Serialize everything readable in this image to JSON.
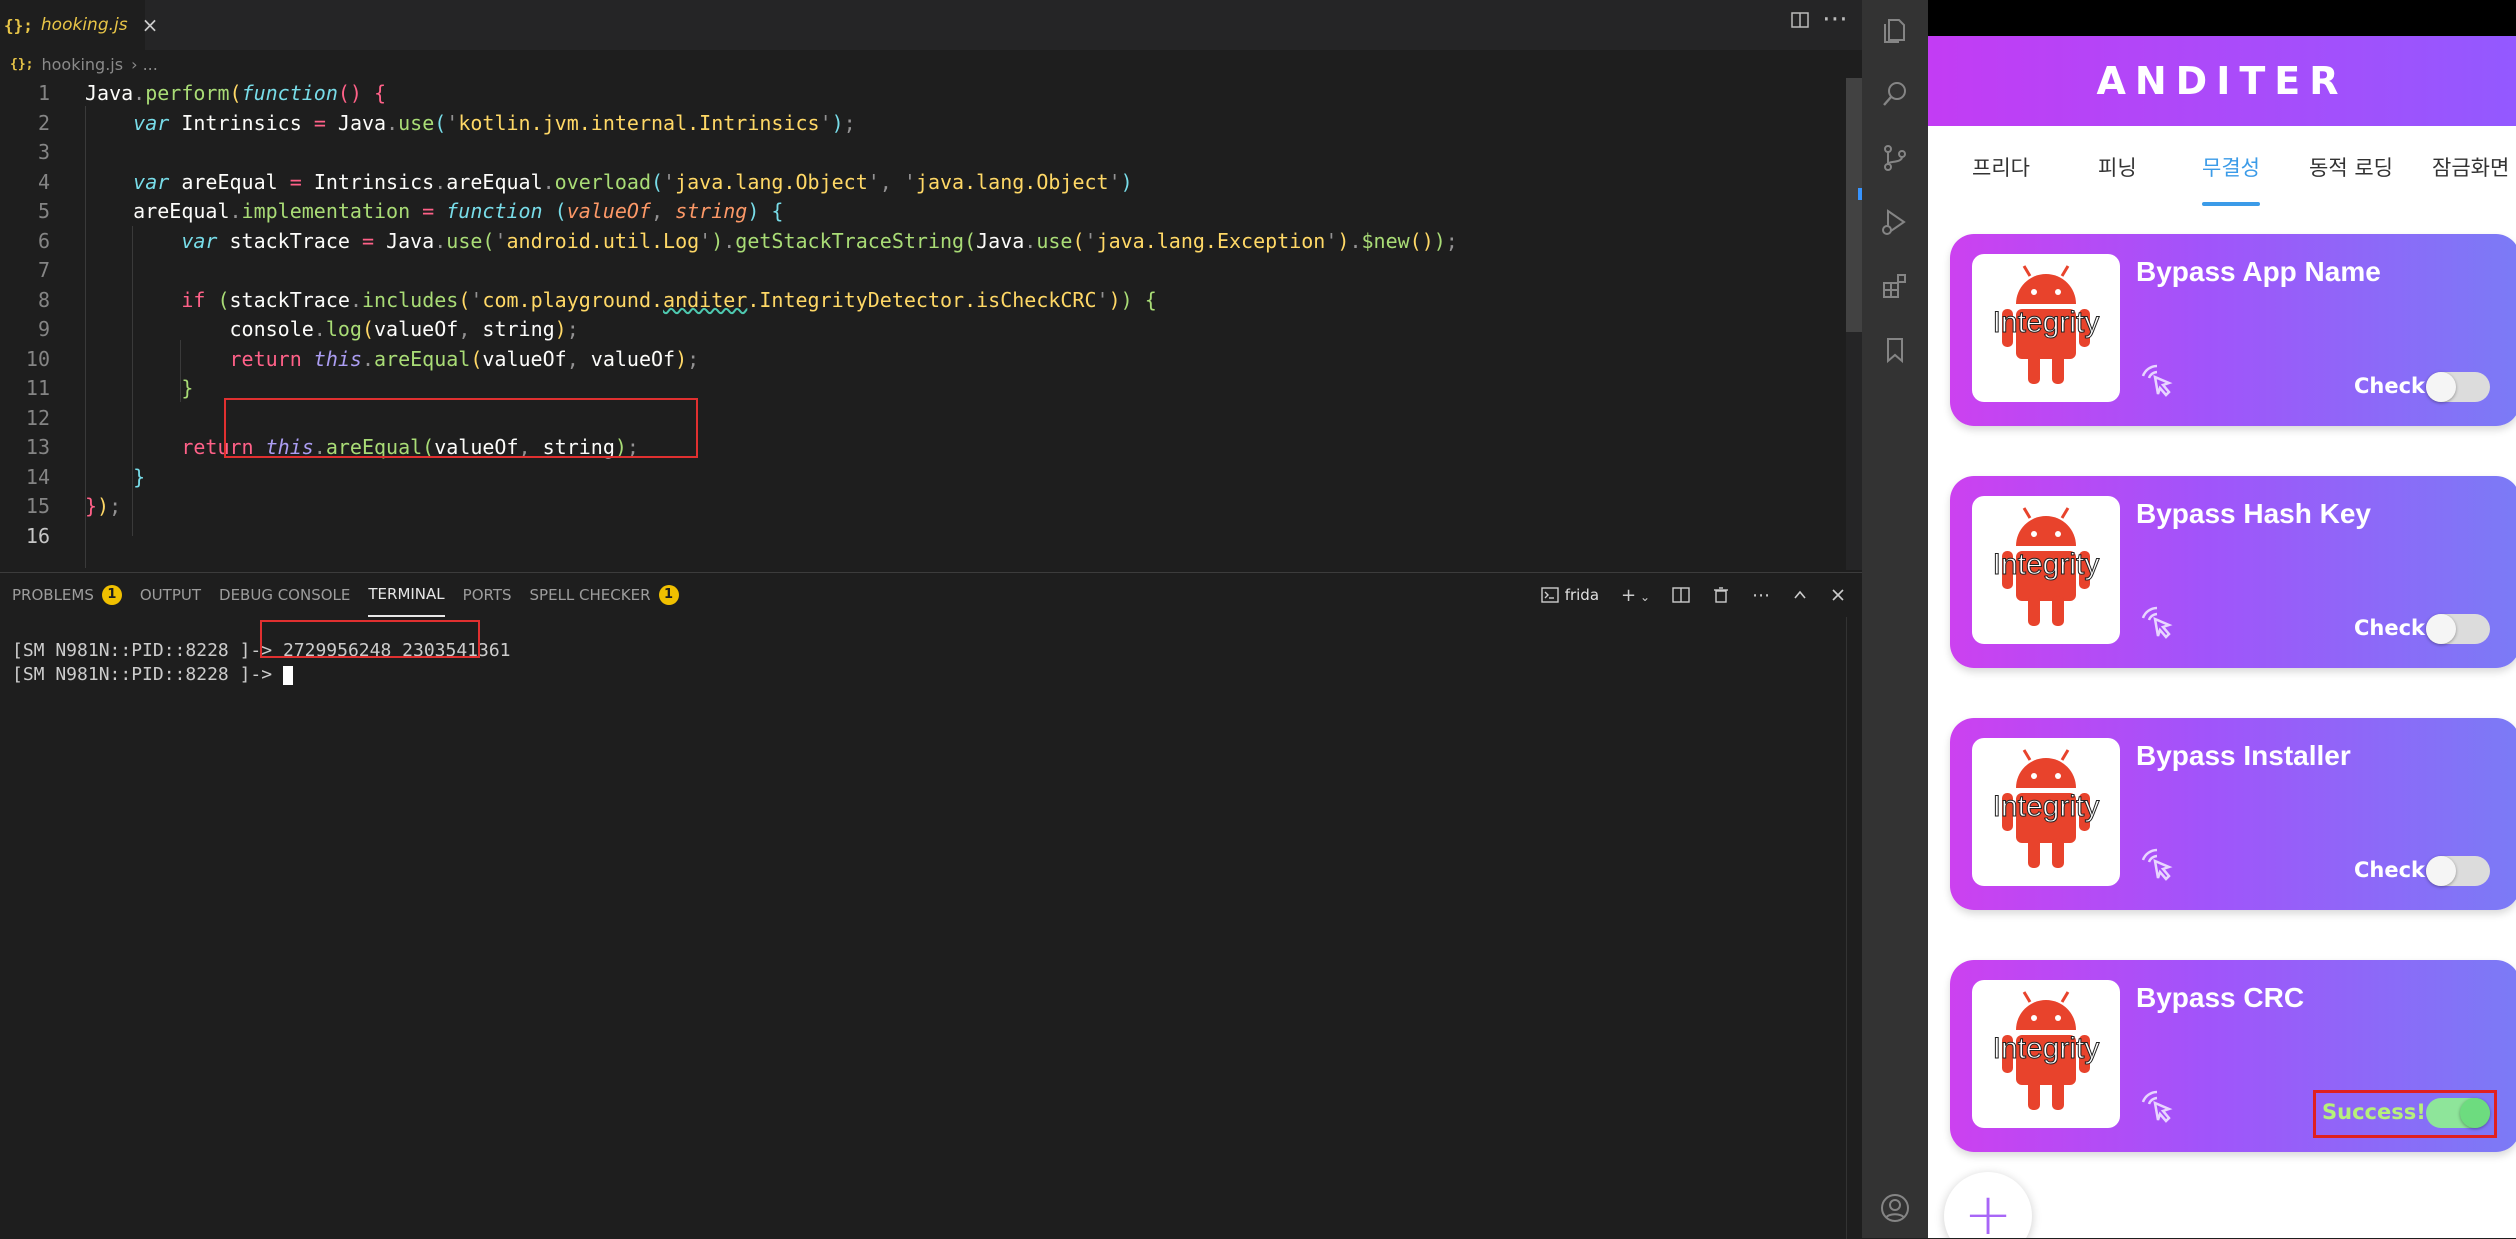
{
  "editor": {
    "tab_label": "hooking.js",
    "tab_icon": "{};",
    "close_glyph": "×",
    "breadcrumb_file": "hooking.js",
    "breadcrumb_rest": "› ...",
    "line_numbers": [
      "1",
      "2",
      "3",
      "4",
      "5",
      "6",
      "7",
      "8",
      "9",
      "10",
      "11",
      "12",
      "13",
      "14",
      "15",
      "16"
    ]
  },
  "panel": {
    "tabs": {
      "problems": "PROBLEMS",
      "problems_badge": "1",
      "output": "OUTPUT",
      "debug_console": "DEBUG CONSOLE",
      "terminal": "TERMINAL",
      "ports": "PORTS",
      "spell_checker": "SPELL CHECKER",
      "spell_badge": "1"
    },
    "terminal_name": "frida",
    "terminal": {
      "prompt": "[SM N981N::PID::8228 ]-> ",
      "output_value": "2729956248 2303541361"
    }
  },
  "app": {
    "title": "ANDITER",
    "tabs": [
      "프리다",
      "피닝",
      "무결성",
      "동적 로딩",
      "잠금화면"
    ],
    "active_tab": "무결성",
    "thumb_label": "Integrity",
    "cards": [
      {
        "title": "Bypass App Name",
        "status_label": "Check",
        "toggle_on": false
      },
      {
        "title": "Bypass Hash Key",
        "status_label": "Check",
        "toggle_on": false
      },
      {
        "title": "Bypass Installer",
        "status_label": "Check",
        "toggle_on": false
      },
      {
        "title": "Bypass CRC",
        "status_label": "Success!",
        "toggle_on": true
      }
    ],
    "fab_glyph": "+"
  },
  "colors": {
    "accent_tab": "#3b9be8",
    "header_gradient_start": "#c33cf4",
    "header_gradient_end": "#9359ff",
    "highlight_red": "#e03030",
    "success_green": "#b6f07a"
  },
  "icons": [
    "explorer-icon",
    "search-icon",
    "source-control-icon",
    "run-debug-icon",
    "extensions-icon",
    "bookmark-icon",
    "account-icon",
    "android-icon",
    "pointer-icon",
    "add-icon"
  ]
}
